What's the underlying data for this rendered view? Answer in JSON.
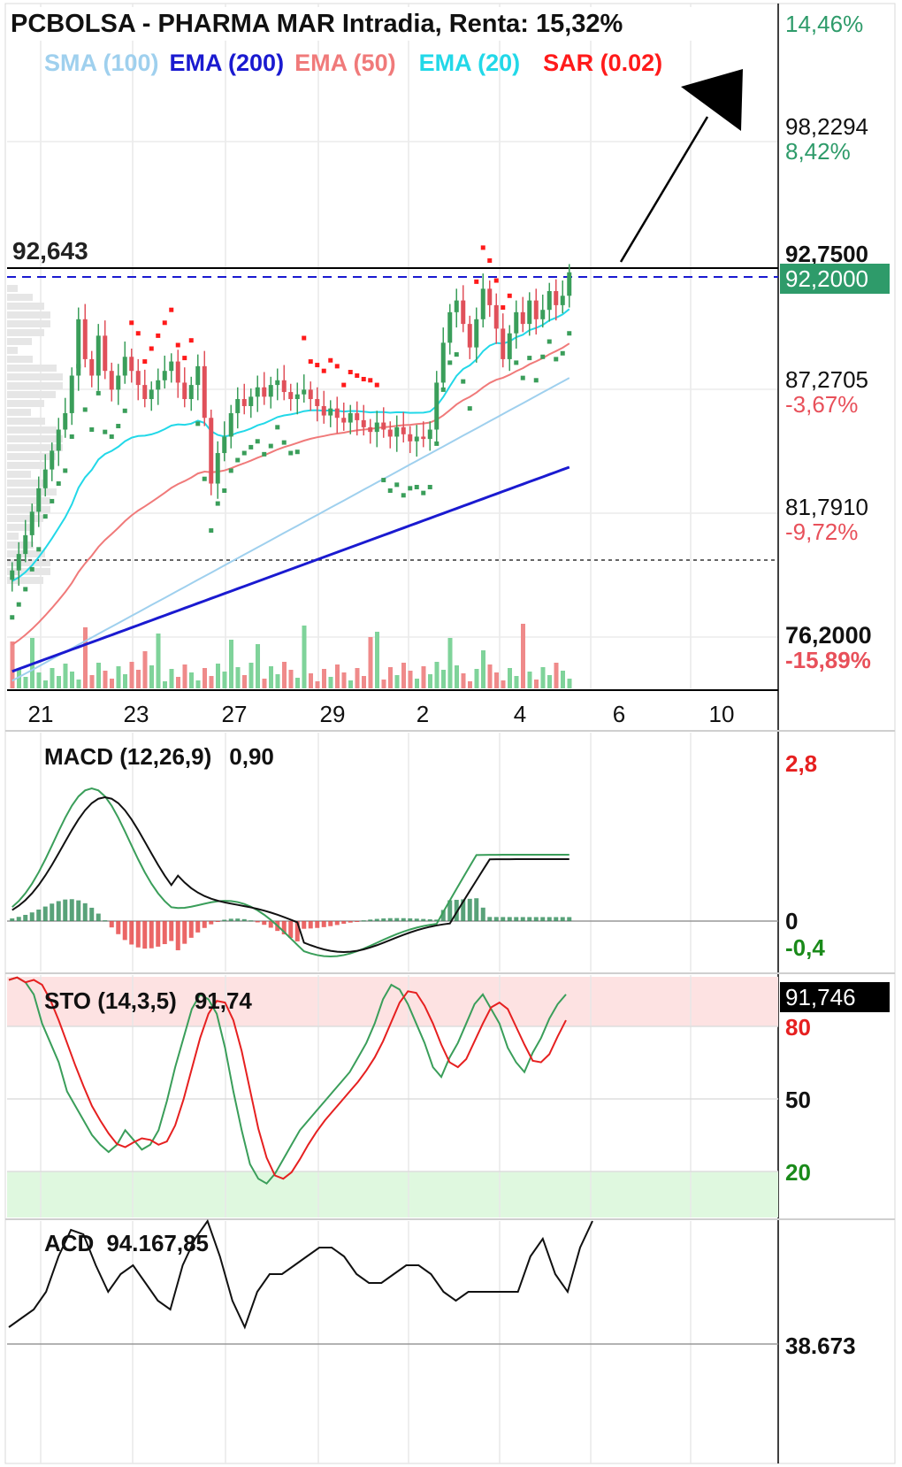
{
  "title": "PCBOLSA - PHARMA MAR Intradia, Renta: 15,32%",
  "colors": {
    "sma100": "#9fd0ee",
    "ema200": "#1a1ad0",
    "ema50": "#f07a7a",
    "ema20": "#22d8e8",
    "sar": "#ff1a1a",
    "up": "#3a9e5a",
    "down": "#e0505a",
    "macd_pos": "#2e8b57",
    "macd_neg": "#e64040",
    "price_tag_bg": "#2e9b6a",
    "pct_pos": "#2e9b6a",
    "pct_neg": "#e8505a"
  },
  "legend": [
    {
      "label": "SMA (100)",
      "color": "#9fd0ee"
    },
    {
      "label": "EMA (200)",
      "color": "#1a1ad0"
    },
    {
      "label": "EMA (50)",
      "color": "#f07a7a"
    },
    {
      "label": "EMA (20)",
      "color": "#22d8e8"
    },
    {
      "label": "SAR (0.02)",
      "color": "#ff1a1a"
    }
  ],
  "x_ticks": [
    "21",
    "23",
    "27",
    "29",
    "2",
    "4",
    "6",
    "10"
  ],
  "price_levels": [
    {
      "value": "98,2294",
      "pct": "8,42%",
      "sign": "pos"
    },
    {
      "value": "87,2705",
      "pct": "-3,67%",
      "sign": "neg"
    },
    {
      "value": "81,7910",
      "pct": "-9,72%",
      "sign": "neg"
    },
    {
      "value": "76,2000",
      "pct": "-15,89%",
      "sign": "neg"
    }
  ],
  "top_pct": "14,46%",
  "resistance_label": "92,643",
  "resistance_axis_label": "92,7500",
  "current_price": "92,2000",
  "chart_data": {
    "type": "candlestick",
    "title": "PCBOLSA - PHARMA MAR Intradia, Renta: 15,32%",
    "ylim": [
      74.4,
      103.8
    ],
    "resistance": 92.643,
    "current": 92.2,
    "support_dotted": 79.2,
    "closes": [
      79.5,
      80.2,
      81.0,
      82.0,
      83.0,
      83.8,
      84.6,
      85.5,
      86.2,
      87.8,
      90.2,
      88.5,
      87.8,
      89.5,
      88.0,
      87.2,
      87.8,
      88.6,
      88.0,
      87.4,
      86.8,
      87.2,
      87.6,
      88.0,
      88.4,
      87.5,
      86.8,
      87.4,
      88.2,
      86.0,
      83.2,
      84.5,
      85.2,
      86.2,
      86.8,
      86.5,
      86.9,
      87.3,
      86.9,
      87.4,
      87.6,
      87.1,
      86.8,
      87.0,
      87.2,
      86.8,
      86.5,
      86.1,
      86.4,
      86.0,
      85.8,
      86.2,
      85.9,
      85.6,
      85.4,
      85.8,
      85.5,
      85.2,
      85.6,
      85.3,
      85.0,
      85.2,
      85.1,
      85.5,
      87.5,
      89.2,
      90.5,
      91.0,
      90.0,
      89.0,
      90.2,
      91.5,
      90.8,
      89.8,
      88.5,
      89.6,
      90.5,
      90.0,
      91.0,
      90.2,
      90.6,
      91.4,
      90.8,
      91.2,
      92.2
    ],
    "indicators": {
      "SMA (100)": {
        "from": 74.8,
        "to": 87.7
      },
      "EMA (200)": {
        "from": 75.2,
        "to": 83.9
      },
      "EMA (50)": {
        "from": 76.2,
        "to": 89.1
      },
      "EMA (20)": {
        "from": 79.0,
        "to": 90.6
      },
      "SAR (0.02)": "dots"
    },
    "macd": {
      "label": "MACD (12,26,9)",
      "value": "0,90",
      "axis": [
        "2,8",
        "0",
        "-0,4"
      ]
    },
    "sto": {
      "label": "STO (14,3,5)",
      "value": "91,74",
      "current_tag": "91,746",
      "levels": [
        "80",
        "50",
        "20"
      ]
    },
    "acd": {
      "label": "ACD",
      "value": "94.167,85",
      "level": "38.673"
    }
  }
}
